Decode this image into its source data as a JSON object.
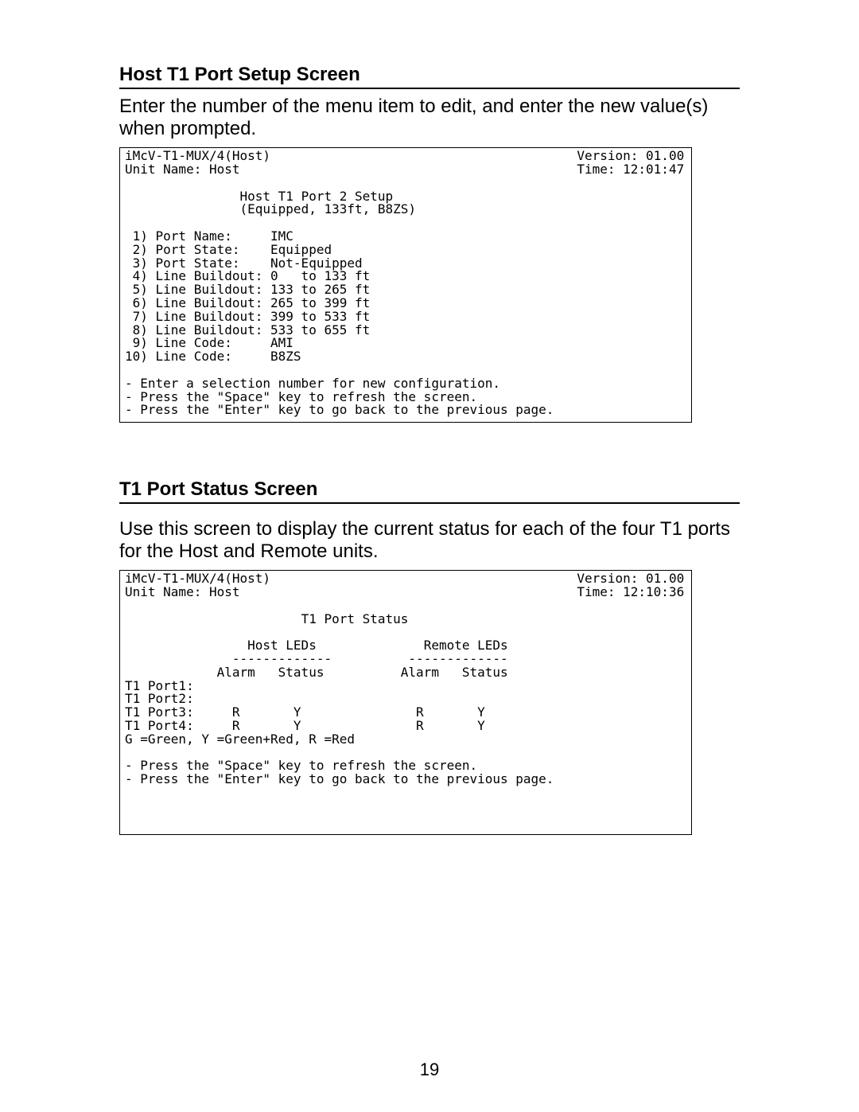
{
  "section1": {
    "heading": "Host T1 Port Setup Screen",
    "intro": "Enter the number of the menu item to edit, and enter the new value(s) when prompted.",
    "screen": {
      "header_left1": "iMcV-T1-MUX/4(Host)",
      "header_left2": "Unit Name: Host",
      "header_right1": "Version: 01.00",
      "header_right2": "Time: 12:01:47",
      "title1": "Host T1 Port 2 Setup",
      "title2": "(Equipped, 133ft, B8ZS)",
      "items": {
        "i1": " 1) Port Name:     IMC",
        "i2": " 2) Port State:    Equipped",
        "i3": " 3) Port State:    Not-Equipped",
        "i4": " 4) Line Buildout: 0   to 133 ft",
        "i5": " 5) Line Buildout: 133 to 265 ft",
        "i6": " 6) Line Buildout: 265 to 399 ft",
        "i7": " 7) Line Buildout: 399 to 533 ft",
        "i8": " 8) Line Buildout: 533 to 655 ft",
        "i9": " 9) Line Code:     AMI",
        "i10": "10) Line Code:     B8ZS"
      },
      "foot1": "- Enter a selection number for new configuration.",
      "foot2": "- Press the \"Space\" key to refresh the screen.",
      "foot3": "- Press the \"Enter\" key to go back to the previous page."
    }
  },
  "section2": {
    "heading": "T1 Port Status Screen",
    "intro": "Use this screen to display the current status for each of the four T1 ports for the Host and Remote units.",
    "screen": {
      "header_left1": "iMcV-T1-MUX/4(Host)",
      "header_left2": "Unit Name: Host",
      "header_right1": "Version: 01.00",
      "header_right2": "Time: 12:10:36",
      "title": "T1 Port Status",
      "grp_host": "Host LEDs",
      "grp_remote": "Remote LEDs",
      "dashes": "-------------",
      "col_headers": "            Alarm   Status          Alarm   Status",
      "row1": "T1 Port1:",
      "row2": "T1 Port2:",
      "row3": "T1 Port3:     R       Y               R       Y",
      "row4": "T1 Port4:     R       Y               R       Y",
      "legend": "G =Green, Y =Green+Red, R =Red",
      "foot1": "- Press the \"Space\" key to refresh the screen.",
      "foot2": "- Press the \"Enter\" key to go back to the previous page."
    }
  },
  "page_number": "19"
}
